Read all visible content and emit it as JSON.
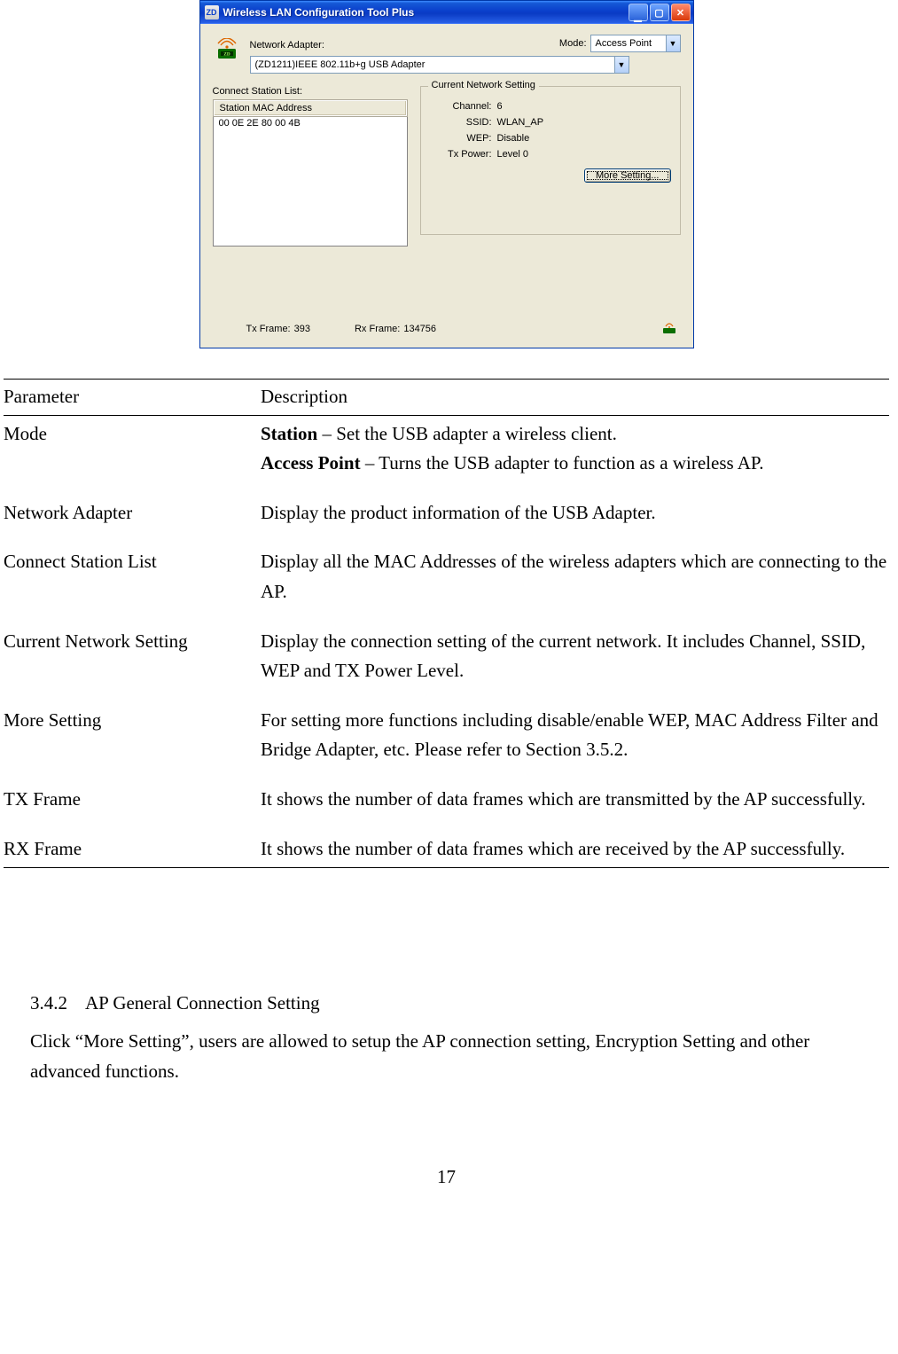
{
  "window": {
    "title": "Wireless LAN Configuration Tool Plus",
    "network_adapter_label": "Network Adapter:",
    "mode_label": "Mode:",
    "mode_value": "Access Point",
    "adapter_value": "(ZD1211)IEEE 802.11b+g USB Adapter",
    "connect_station_label": "Connect Station List:",
    "list_header": "Station MAC Address",
    "list_row0": "00 0E 2E 80 00 4B",
    "fieldset_legend": "Current Network Setting",
    "kv": {
      "channel_k": "Channel:",
      "channel_v": "6",
      "ssid_k": "SSID:",
      "ssid_v": "WLAN_AP",
      "wep_k": "WEP:",
      "wep_v": "Disable",
      "txpower_k": "Tx Power:",
      "txpower_v": "Level 0"
    },
    "more_btn": "More Setting...",
    "txframe_k": "Tx Frame:",
    "txframe_v": "393",
    "rxframe_k": "Rx Frame:",
    "rxframe_v": "134756"
  },
  "table": {
    "head_param": "Parameter",
    "head_desc": "Description",
    "rows": {
      "mode_param": "Mode",
      "mode_b1": "Station",
      "mode_t1": " – Set the USB adapter a wireless client.",
      "mode_b2": "Access Point",
      "mode_t2": " – Turns the USB adapter to function as a wireless AP.",
      "na_param": "Network Adapter",
      "na_desc": "Display the product information of the USB Adapter.",
      "csl_param": "Connect Station List",
      "csl_desc": "Display all the MAC Addresses of the wireless adapters which are connecting to the AP.",
      "cns_param": "Current Network Setting",
      "cns_desc": "Display the connection setting of the current network.  It includes Channel, SSID, WEP and TX Power Level.",
      "ms_param": "More Setting",
      "ms_desc": "For setting more functions including disable/enable WEP, MAC Address Filter and Bridge Adapter, etc. Please refer to Section 3.5.2.",
      "tx_param": "TX Frame",
      "tx_desc": "It shows the number of data frames which are transmitted by the AP successfully.",
      "rx_param": "RX Frame",
      "rx_desc": "It shows the number of data frames which are received by the AP successfully."
    }
  },
  "section": {
    "num": "3.4.2",
    "title": "AP General Connection Setting",
    "body": "Click “More Setting”, users are allowed to setup the AP connection setting, Encryption Setting and other advanced functions."
  },
  "page_number": "17"
}
